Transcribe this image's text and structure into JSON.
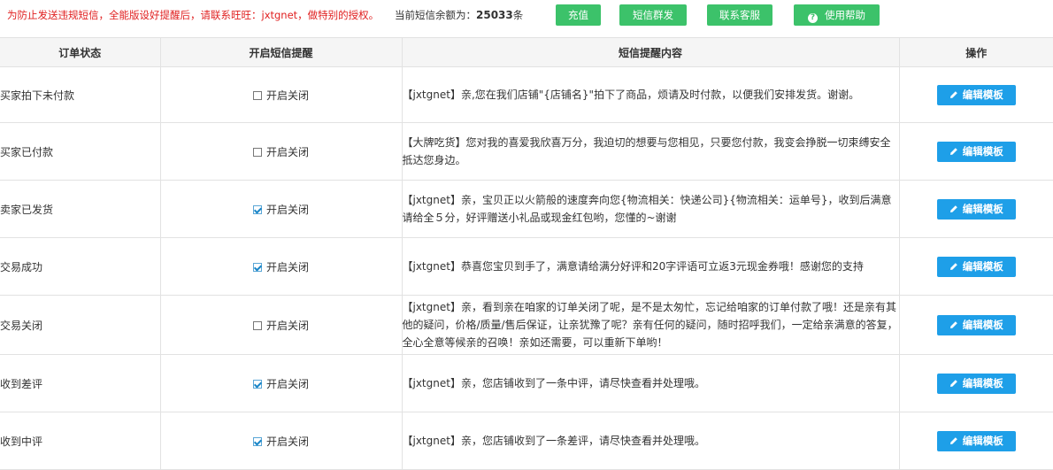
{
  "header": {
    "notice": "为防止发送违规短信，全能版设好提醒后，请联系旺旺：jxtgnet，做特别的授权。",
    "balance_label": "当前短信余额为：",
    "balance_value": "25033",
    "balance_unit": "条",
    "buttons": {
      "recharge": "充值",
      "mass_sms": "短信群发",
      "contact": "联系客服",
      "help": "使用帮助"
    },
    "help_icon_glyph": "?"
  },
  "table": {
    "columns": [
      "订单状态",
      "开启短信提醒",
      "短信提醒内容",
      "操作"
    ],
    "toggle_label": "开启关闭",
    "edit_label": "编辑模板",
    "rows": [
      {
        "status": "买家拍下未付款",
        "enabled": false,
        "content": "【jxtgnet】亲,您在我们店铺\"{店铺名}\"拍下了商品，烦请及时付款，以便我们安排发货。谢谢。"
      },
      {
        "status": "买家已付款",
        "enabled": false,
        "content": "【大牌吃货】您对我的喜爱我欣喜万分，我迫切的想要与您相见，只要您付款，我变会挣脱一切束缚安全抵达您身边。"
      },
      {
        "status": "卖家已发货",
        "enabled": true,
        "content": "【jxtgnet】亲，宝贝正以火箭般的速度奔向您{物流相关：快递公司}{物流相关：运单号}，收到后满意请给全５分，好评赠送小礼品或现金红包哟，您懂的~谢谢"
      },
      {
        "status": "交易成功",
        "enabled": true,
        "content": "【jxtgnet】恭喜您宝贝到手了，满意请给满分好评和20字评语可立返3元现金券哦！感谢您的支持"
      },
      {
        "status": "交易关闭",
        "enabled": false,
        "content": "【jxtgnet】亲，看到亲在咱家的订单关闭了呢，是不是太匆忙，忘记给咱家的订单付款了哦！还是亲有其他的疑问，价格/质量/售后保证，让亲犹豫了呢？亲有任何的疑问，随时招呼我们，一定给亲满意的答复，全心全意等候亲的召唤！亲如还需要，可以重新下单哟！"
      },
      {
        "status": "收到差评",
        "enabled": true,
        "content": "【jxtgnet】亲，您店铺收到了一条中评，请尽快查看并处理哦。"
      },
      {
        "status": "收到中评",
        "enabled": true,
        "content": "【jxtgnet】亲，您店铺收到了一条差评，请尽快查看并处理哦。"
      }
    ]
  },
  "colors": {
    "notice_red": "#e02020",
    "green_button": "#3cc26a",
    "blue_button": "#1e9fe8",
    "header_bg": "#f5f5f5"
  }
}
